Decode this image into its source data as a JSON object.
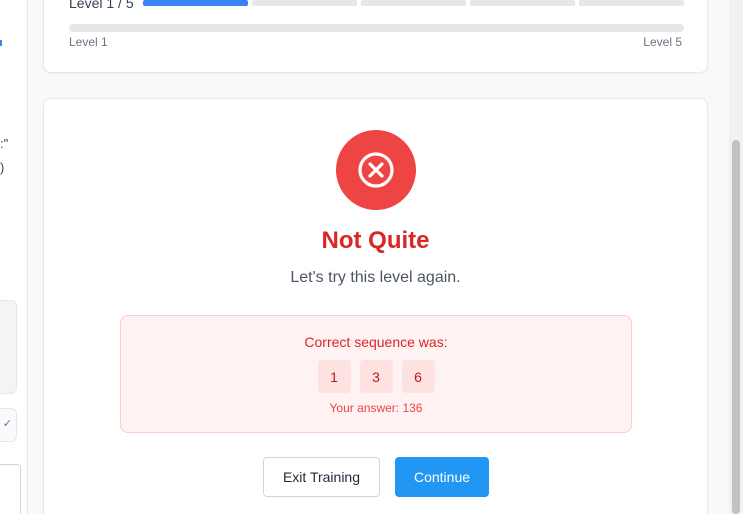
{
  "side_panel": {
    "fragment_1": ":\"",
    "fragment_2": ")",
    "chevron": "✓"
  },
  "progress": {
    "level_label": "Level 1 / 5",
    "segments_total": 5,
    "segments_completed": 1,
    "track_min_label": "Level 1",
    "track_max_label": "Level 5"
  },
  "result": {
    "icon": "x-circle-icon",
    "title": "Not Quite",
    "subtitle": "Let's try this level again.",
    "sequence_label": "Correct sequence was:",
    "sequence": [
      "1",
      "3",
      "6"
    ],
    "your_answer": "Your answer: 136"
  },
  "actions": {
    "exit_label": "Exit Training",
    "continue_label": "Continue"
  },
  "colors": {
    "accent": "#3b82f6",
    "error": "#ef4444",
    "error_text": "#dc2626",
    "primary_button": "#2196f3"
  }
}
